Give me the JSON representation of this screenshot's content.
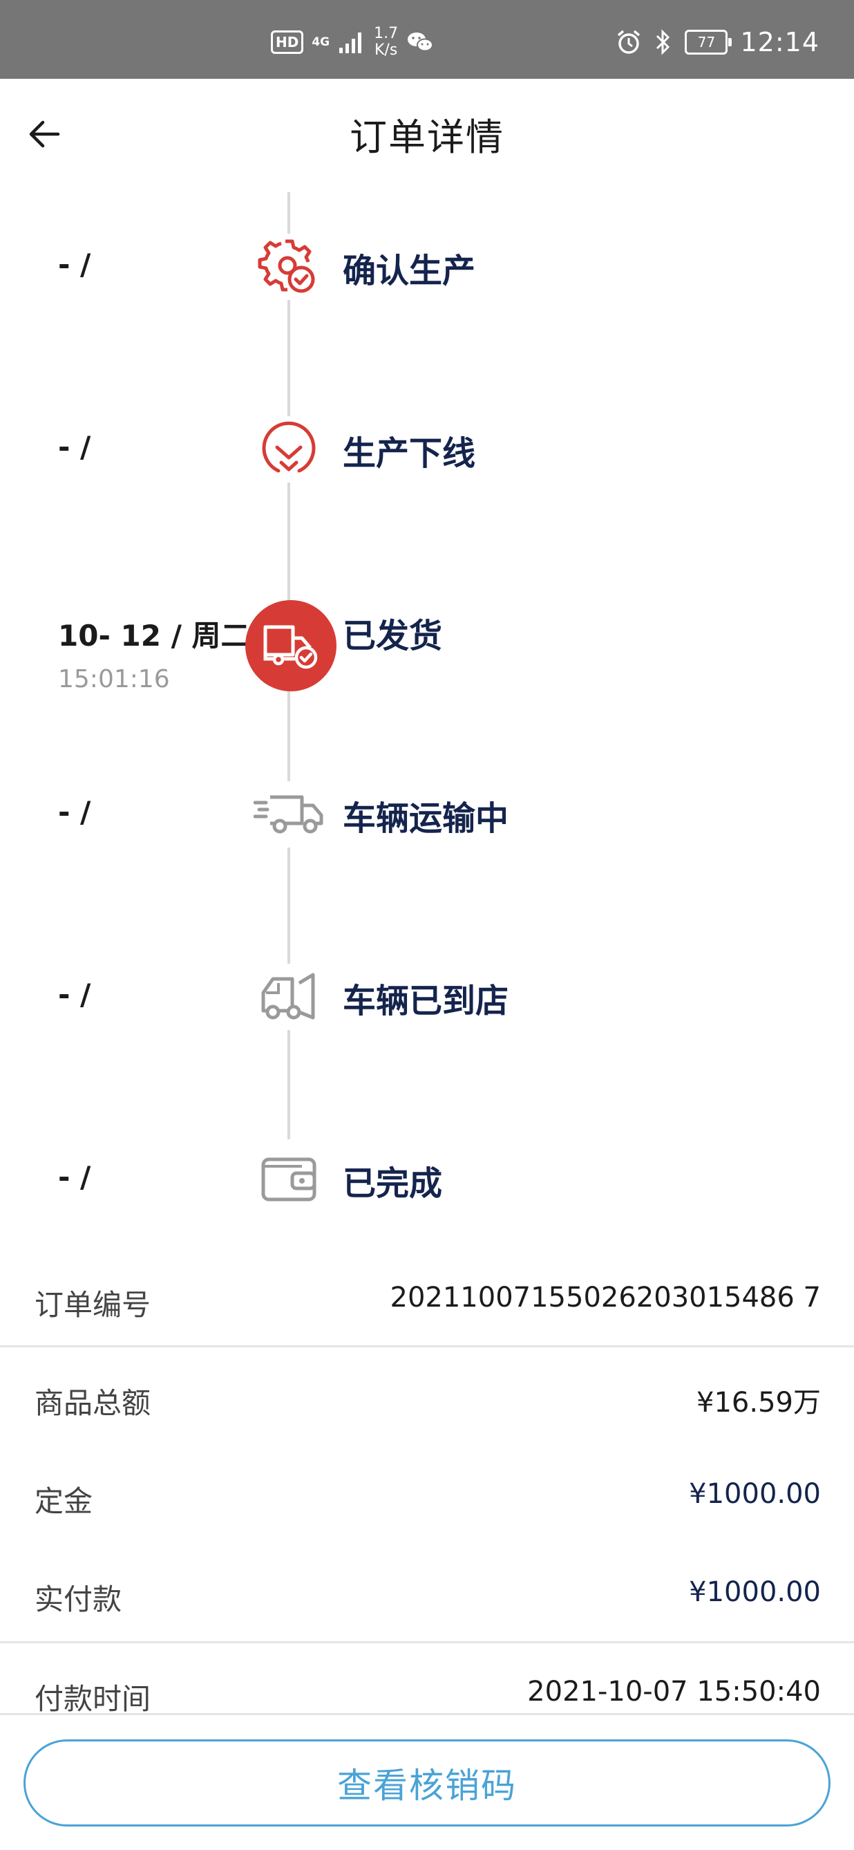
{
  "status_bar": {
    "hd": "HD",
    "network": "4G",
    "speed_value": "1.7",
    "speed_unit": "K/s",
    "battery": "77",
    "time": "12:14"
  },
  "header": {
    "title": "订单详情"
  },
  "timeline": [
    {
      "date": "- /",
      "time": "",
      "label": "确认生产",
      "icon": "gear-check-icon",
      "active": false
    },
    {
      "date": "- /",
      "time": "",
      "label": "生产下线",
      "icon": "circle-chevron-down-icon",
      "active": false
    },
    {
      "date": "10- 12 / 周二",
      "time": "15:01:16",
      "label": "已发货",
      "icon": "truck-check-icon",
      "active": true
    },
    {
      "date": "- /",
      "time": "",
      "label": "车辆运输中",
      "icon": "moving-truck-icon",
      "active": false
    },
    {
      "date": "- /",
      "time": "",
      "label": "车辆已到店",
      "icon": "truck-arrived-icon",
      "active": false
    },
    {
      "date": "- /",
      "time": "",
      "label": "已完成",
      "icon": "wallet-icon",
      "active": false
    }
  ],
  "details": {
    "order_no_label": "订单编号",
    "order_no_value": "20211007155026203015486 7",
    "goods_total_label": "商品总额",
    "goods_total_value": "¥16.59万",
    "deposit_label": "定金",
    "deposit_value": "¥1000.00",
    "paid_label": "实付款",
    "paid_value": "¥1000.00",
    "pay_time_label": "付款时间",
    "pay_time_value": "2021-10-07 15:50:40"
  },
  "bottom_button": {
    "label": "查看核销码"
  },
  "colors": {
    "accent_red": "#d63c35",
    "navy": "#14244d",
    "inactive_gray": "#9a9a9a",
    "button_blue": "#4aa3d6"
  }
}
